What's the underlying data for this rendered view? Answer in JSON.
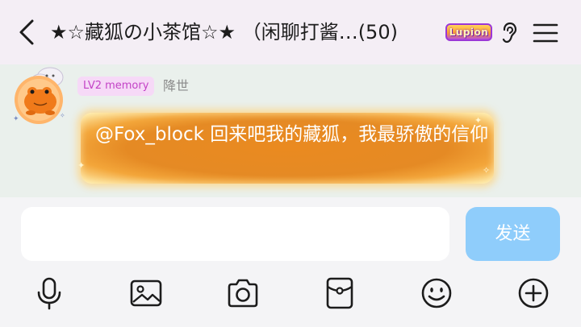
{
  "header": {
    "title": "★☆藏狐の小茶馆☆★ （闲聊打酱…(50)",
    "badge_text": "Lupion",
    "icons": [
      "chevron-left-icon",
      "ear-icon",
      "menu-icon"
    ]
  },
  "message": {
    "level_badge": "LV2 memory",
    "nickname": "降世",
    "text": "@Fox_block 回来吧我的藏狐，我最骄傲的信仰",
    "avatar": "frog-avatar"
  },
  "composer": {
    "input_value": "",
    "send_label": "发送"
  },
  "toolbar": {
    "icons": [
      "microphone-icon",
      "image-icon",
      "camera-icon",
      "red-packet-icon",
      "emoji-icon",
      "plus-icon"
    ]
  },
  "colors": {
    "header_bg": "#f4eef5",
    "chat_bg": "#eaf0ec",
    "bubble": "#e58a24",
    "send_button": "#8fcdfb",
    "level_badge_text": "#c342c6"
  }
}
